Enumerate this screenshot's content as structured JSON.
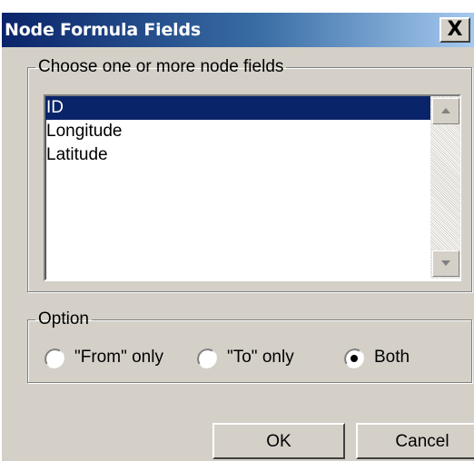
{
  "window": {
    "title": "Node Formula Fields",
    "close_label": "X"
  },
  "fields_group": {
    "legend": "Choose one or more node fields",
    "items": [
      {
        "label": "ID",
        "selected": true
      },
      {
        "label": "Longitude",
        "selected": false
      },
      {
        "label": "Latitude",
        "selected": false
      }
    ]
  },
  "option_group": {
    "legend": "Option",
    "options": [
      {
        "label": "\"From\" only",
        "checked": false
      },
      {
        "label": "\"To\" only",
        "checked": false
      },
      {
        "label": "Both",
        "checked": true
      }
    ]
  },
  "buttons": {
    "ok_label": "OK",
    "cancel_label": "Cancel"
  },
  "colors": {
    "selection": "#0a246a",
    "title_gradient_start": "#0a246a",
    "face": "#d4d0c8"
  },
  "icons": [
    "close-icon",
    "scroll-up-arrow-icon",
    "scroll-down-arrow-icon"
  ]
}
